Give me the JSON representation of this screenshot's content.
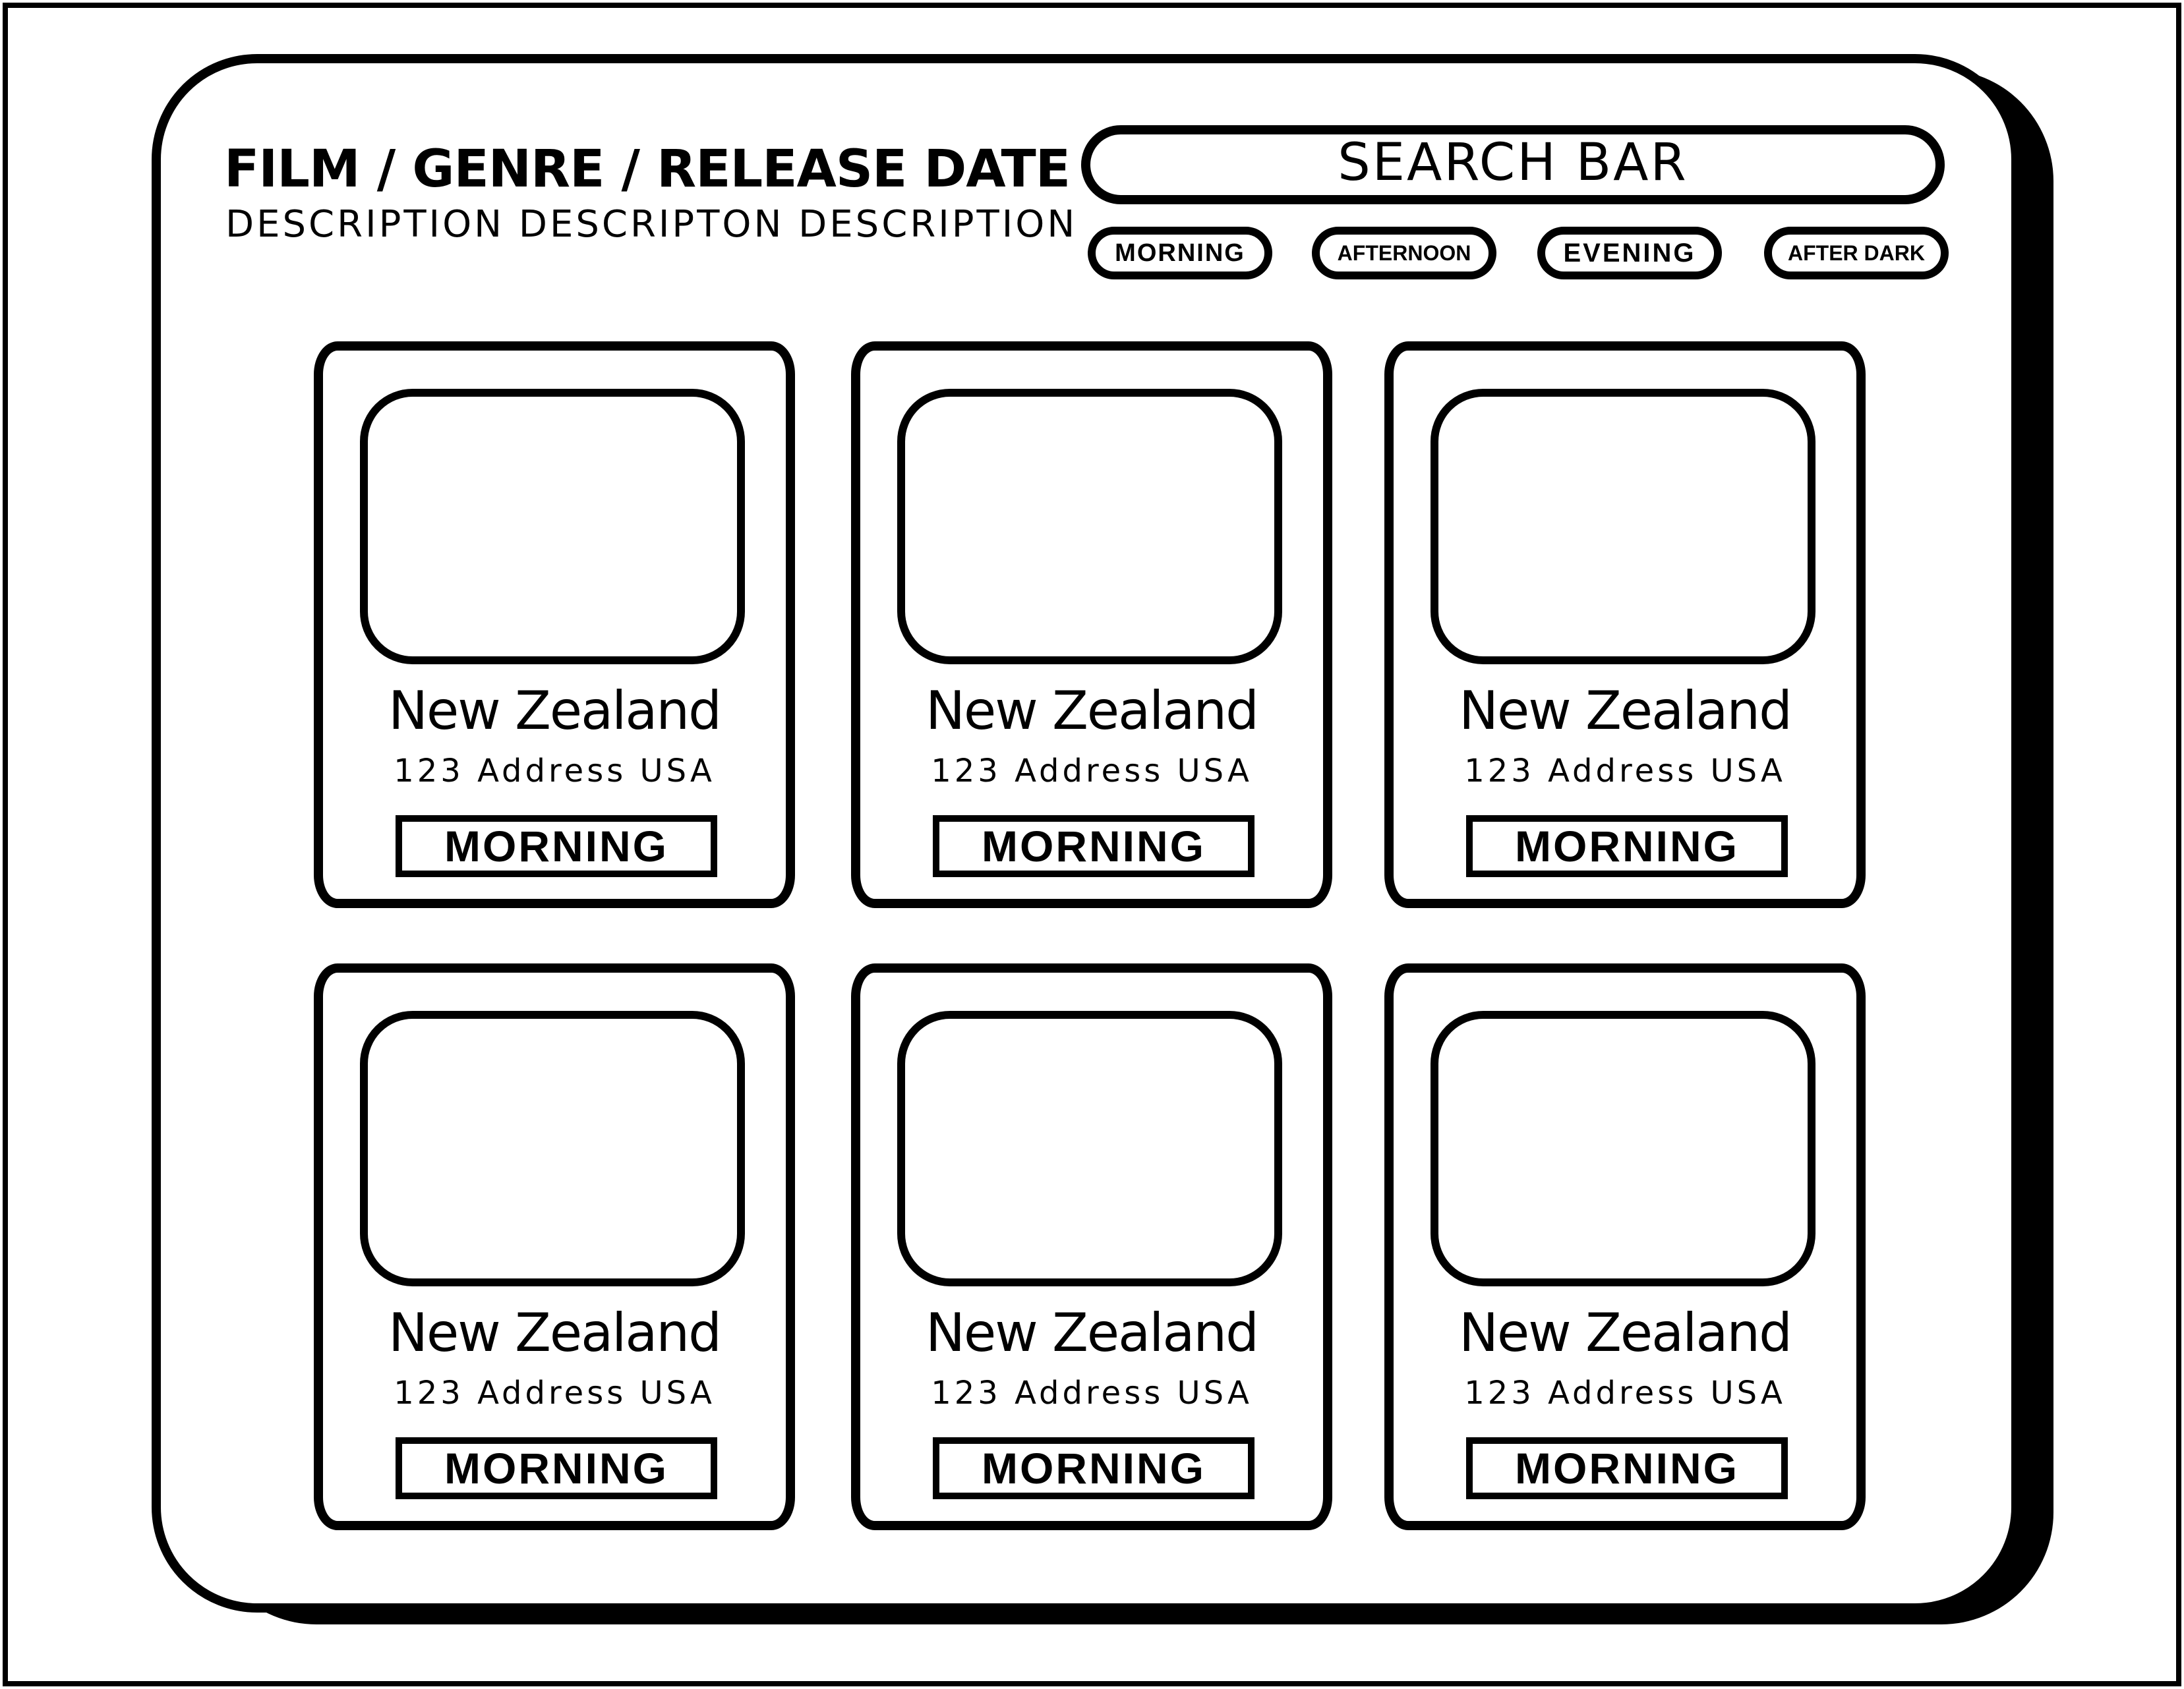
{
  "header": {
    "title": "FILM / GENRE / RELEASE DATE",
    "subtitle": "DESCRIPTION DESCRIPTON DESCRIPTION"
  },
  "search": {
    "label": "SEARCH BAR"
  },
  "filters": [
    {
      "label": "MORNING"
    },
    {
      "label": "AFTERNOON"
    },
    {
      "label": "EVENING"
    },
    {
      "label": "AFTER DARK"
    }
  ],
  "cards": [
    {
      "name": "New Zealand",
      "address": "123 Address USA",
      "time": "MORNING"
    },
    {
      "name": "New Zealand",
      "address": "123 Address USA",
      "time": "MORNING"
    },
    {
      "name": "New Zealand",
      "address": "123 Address USA",
      "time": "MORNING"
    },
    {
      "name": "New Zealand",
      "address": "123 Address USA",
      "time": "MORNING"
    },
    {
      "name": "New Zealand",
      "address": "123 Address USA",
      "time": "MORNING"
    },
    {
      "name": "New Zealand",
      "address": "123 Address USA",
      "time": "MORNING"
    }
  ],
  "colors": {
    "stroke": "#000000",
    "background": "#ffffff"
  }
}
